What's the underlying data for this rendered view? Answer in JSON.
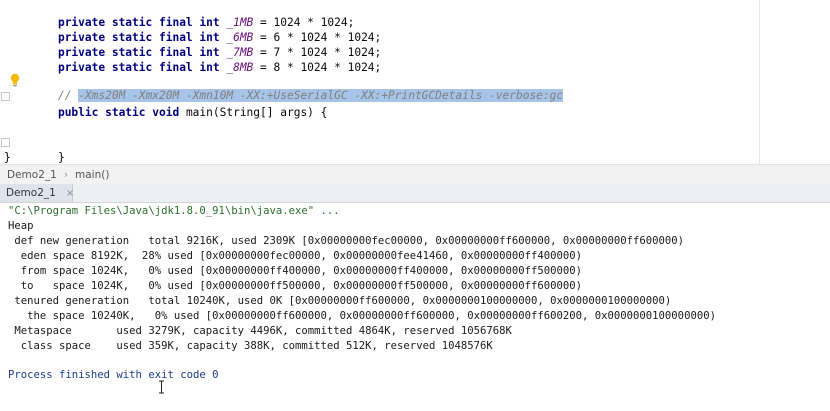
{
  "editor": {
    "constants": [
      {
        "mods": "private static final int ",
        "name": "_1MB",
        "expr": " = 1024 * 1024;"
      },
      {
        "mods": "private static final int ",
        "name": "_6MB",
        "expr": " = 6 * 1024 * 1024;"
      },
      {
        "mods": "private static final int ",
        "name": "_7MB",
        "expr": " = 7 * 1024 * 1024;"
      },
      {
        "mods": "private static final int ",
        "name": "_8MB",
        "expr": " = 8 * 1024 * 1024;"
      }
    ],
    "comment_prefix": "// ",
    "comment_selected": "-Xms20M -Xmx20M -Xmn10M -XX:+UseSerialGC -XX:+PrintGCDetails -verbose:gc",
    "main_signature_kw": "public static void ",
    "main_signature_rest": "main(String[] args) {",
    "inner_close": "}",
    "outer_close": "}"
  },
  "breadcrumb": {
    "class_name": "Demo2_1",
    "separator": "›",
    "method_name": "main()"
  },
  "run_panel": {
    "tab_label": "Demo2_1",
    "tab_close": "×"
  },
  "console": {
    "command": "\"C:\\Program Files\\Java\\jdk1.8.0_91\\bin\\java.exe\" ...",
    "lines": [
      "Heap",
      " def new generation   total 9216K, used 2309K [0x00000000fec00000, 0x00000000ff600000, 0x00000000ff600000)",
      "  eden space 8192K,  28% used [0x00000000fec00000, 0x00000000fee41460, 0x00000000ff400000)",
      "  from space 1024K,   0% used [0x00000000ff400000, 0x00000000ff400000, 0x00000000ff500000)",
      "  to   space 1024K,   0% used [0x00000000ff500000, 0x00000000ff500000, 0x00000000ff600000)",
      " tenured generation   total 10240K, used 0K [0x00000000ff600000, 0x0000000100000000, 0x0000000100000000)",
      "   the space 10240K,   0% used [0x00000000ff600000, 0x00000000ff600000, 0x00000000ff600200, 0x0000000100000000)",
      " Metaspace       used 3279K, capacity 4496K, committed 4864K, reserved 1056768K",
      "  class space    used 359K, capacity 388K, committed 512K, reserved 1048576K"
    ],
    "exit_message": "Process finished with exit code 0"
  },
  "colors": {
    "keyword": "#000080",
    "constant": "#660e7a",
    "number": "#0000ff",
    "selection": "#a6c3e8",
    "console_command": "#2d6e2d",
    "bulb": "#f5b800"
  },
  "icons": {
    "intention_bulb": "lightbulb-icon",
    "fold": "fold-marker-icon",
    "text_cursor": "i-beam-cursor-icon"
  }
}
